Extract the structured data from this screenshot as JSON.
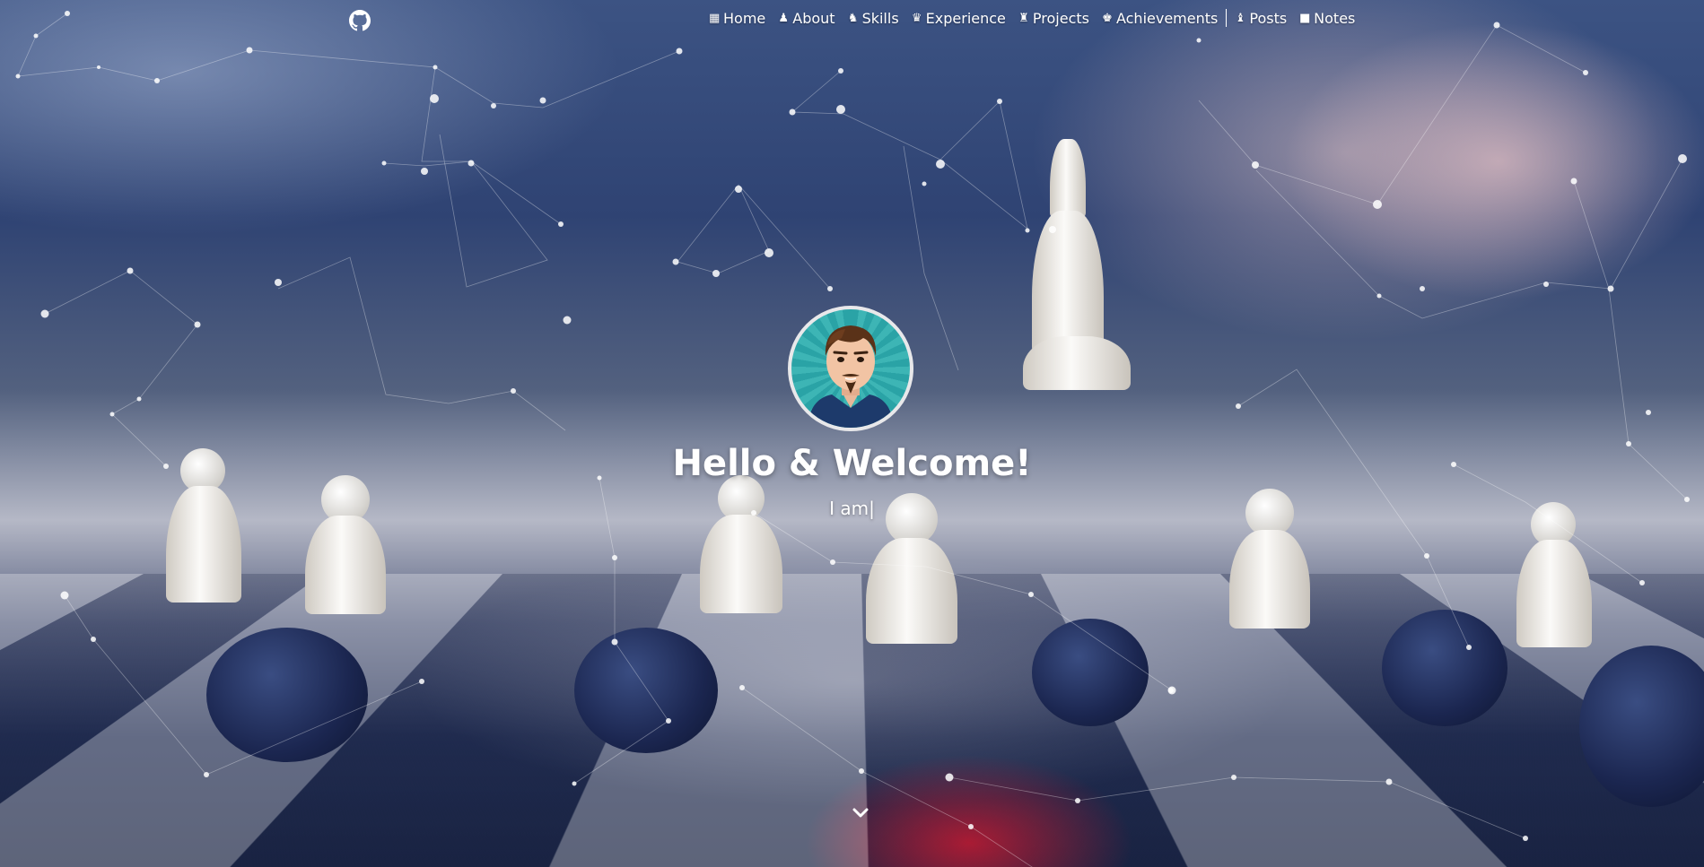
{
  "header": {
    "github_icon": "github-icon",
    "nav": [
      {
        "icon": "chessboard-icon",
        "glyph": "▦",
        "label": "Home"
      },
      {
        "icon": "pawn-icon",
        "glyph": "♟",
        "label": "About"
      },
      {
        "icon": "knight-icon",
        "glyph": "♞",
        "label": "Skills"
      },
      {
        "icon": "queen-icon",
        "glyph": "♛",
        "label": "Experience"
      },
      {
        "icon": "rook-icon",
        "glyph": "♜",
        "label": "Projects"
      },
      {
        "icon": "king-icon",
        "glyph": "♚",
        "label": "Achievements"
      },
      {
        "icon": "bishop-icon",
        "glyph": "♝",
        "label": "Posts"
      },
      {
        "icon": "notes-icon",
        "glyph": "■",
        "label": "Notes"
      }
    ]
  },
  "hero": {
    "title": "Hello & Welcome!",
    "subtitle": "I am|",
    "scroll_icon": "chevron-down-icon"
  },
  "colors": {
    "text": "#ffffff",
    "accent_glow": "#ff1428",
    "avatar_bg": "#2aa3a6"
  }
}
